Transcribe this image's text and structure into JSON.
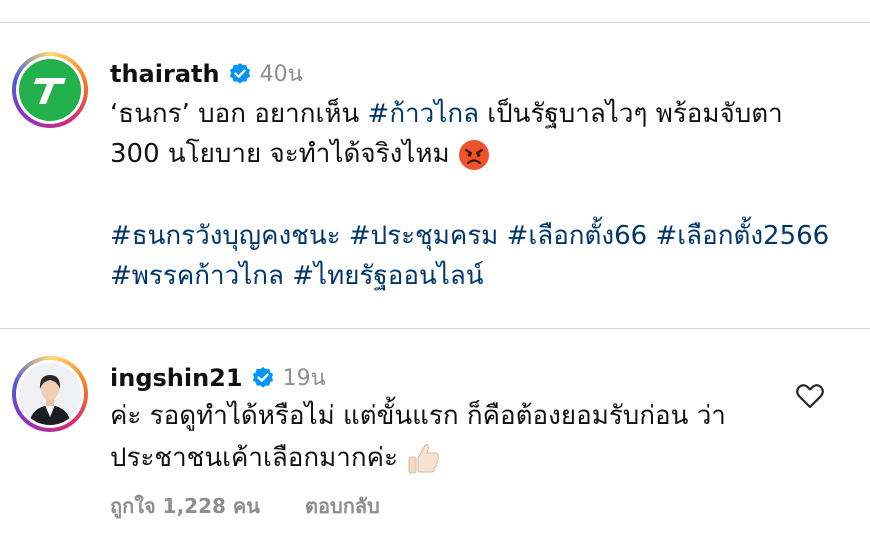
{
  "post": {
    "username": "thairath",
    "time": "40น",
    "caption": {
      "line1_prefix": "‘ธนกร’ บอก อยากเห็น",
      "line1_tag": "#ก้าวไกล",
      "line1_suffix": "เป็นรัฐบาลไวๆ พร้อมจับตา",
      "line2": "300 นโยบาย จะทำได้จริงไหม",
      "emoji": "angry-face-emoji"
    },
    "hashtags_line1": "#ธนกรวังบุญคงชนะ #ประชุมครม #เลือกตั้ง66 #เลือกตั้ง2566",
    "hashtags_line2": "#พรรคก้าวไกล #ไทยรัฐออนไลน์"
  },
  "comment": {
    "username": "ingshin21",
    "time": "19น",
    "line1": "ค่ะ รอดูทำได้หรือไม่ แต่ขั้นแรก ก็คือต้องยอมรับก่อน ว่า",
    "line2": "ประชาชนเค้าเลือกมากค่ะ",
    "emoji": "thumbs-up-emoji",
    "likes": "ถูกใจ 1,228 คน",
    "reply": "ตอบกลับ"
  },
  "colors": {
    "hashtag": "#00376b",
    "verified": "#0095f6",
    "secondary": "#8e8e8e",
    "logo_green": "#23b14d"
  }
}
